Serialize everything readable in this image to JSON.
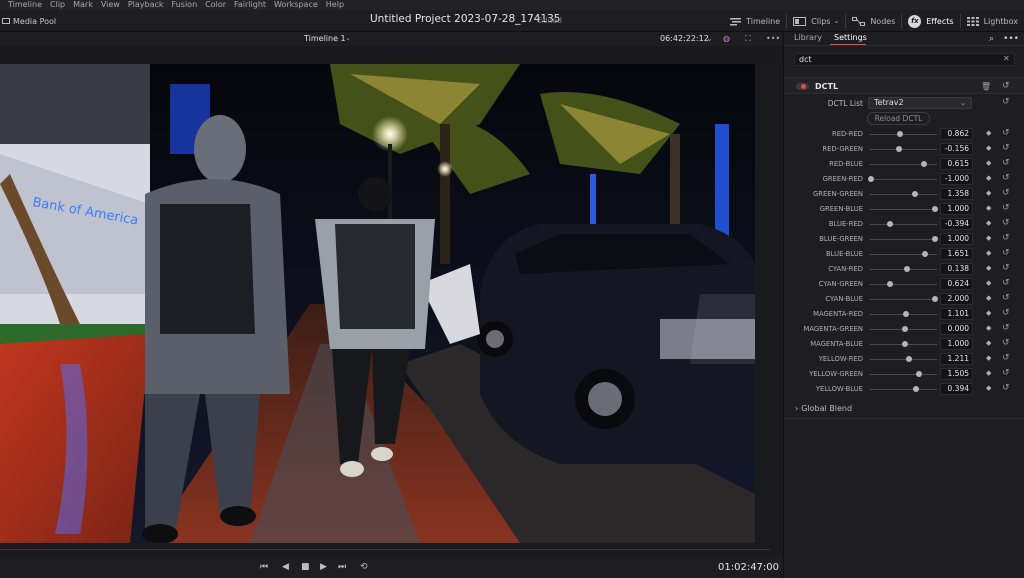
{
  "menu": [
    "Timeline",
    "Clip",
    "Mark",
    "View",
    "Playback",
    "Fusion",
    "Color",
    "Fairlight",
    "Workspace",
    "Help"
  ],
  "header": {
    "media_pool": "Media Pool",
    "project_title": "Untitled Project 2023-07-28_174135",
    "edited": "Edited",
    "nav": [
      {
        "label": "Timeline",
        "icon": "timeline-icon",
        "active": false
      },
      {
        "label": "Clips",
        "icon": "clips-icon",
        "active": false
      },
      {
        "label": "Nodes",
        "icon": "nodes-icon",
        "active": false
      },
      {
        "label": "Effects",
        "icon": "fx-icon",
        "active": true
      },
      {
        "label": "Lightbox",
        "icon": "lightbox-icon",
        "active": false
      }
    ]
  },
  "viewer": {
    "timeline_name": "Timeline 1",
    "timecode_top": "06:42:22:12",
    "timecode_bottom": "01:02:47:00",
    "sign_text": "Bank of America"
  },
  "panel": {
    "tabs": [
      "Library",
      "Settings"
    ],
    "active_tab": "Settings",
    "search_value": "dct",
    "effect_title": "DCTL",
    "dctl_list_label": "DCTL List",
    "dctl_list_value": "Tetrav2",
    "reload_label": "Reload DCTL",
    "global_blend": "Global Blend",
    "params": [
      {
        "label": "RED-RED",
        "value": "0.862",
        "pos": 0.45
      },
      {
        "label": "RED-GREEN",
        "value": "-0.156",
        "pos": 0.43
      },
      {
        "label": "RED-BLUE",
        "value": "0.615",
        "pos": 0.8
      },
      {
        "label": "GREEN-RED",
        "value": "-1.000",
        "pos": 0.02
      },
      {
        "label": "GREEN-GREEN",
        "value": "1.358",
        "pos": 0.67
      },
      {
        "label": "GREEN-BLUE",
        "value": "1.000",
        "pos": 0.97
      },
      {
        "label": "BLUE-RED",
        "value": "-0.394",
        "pos": 0.3
      },
      {
        "label": "BLUE-GREEN",
        "value": "1.000",
        "pos": 0.97
      },
      {
        "label": "BLUE-BLUE",
        "value": "1.651",
        "pos": 0.82
      },
      {
        "label": "CYAN-RED",
        "value": "0.138",
        "pos": 0.55
      },
      {
        "label": "CYAN-GREEN",
        "value": "0.624",
        "pos": 0.3
      },
      {
        "label": "CYAN-BLUE",
        "value": "2.000",
        "pos": 0.97
      },
      {
        "label": "MAGENTA-RED",
        "value": "1.101",
        "pos": 0.53
      },
      {
        "label": "MAGENTA-GREEN",
        "value": "0.000",
        "pos": 0.52
      },
      {
        "label": "MAGENTA-BLUE",
        "value": "1.000",
        "pos": 0.52
      },
      {
        "label": "YELLOW-RED",
        "value": "1.211",
        "pos": 0.58
      },
      {
        "label": "YELLOW-GREEN",
        "value": "1.505",
        "pos": 0.73
      },
      {
        "label": "YELLOW-BLUE",
        "value": "0.394",
        "pos": 0.68
      }
    ]
  },
  "colors": {
    "accent": "#e64a4a",
    "bg": "#1e1e20"
  }
}
